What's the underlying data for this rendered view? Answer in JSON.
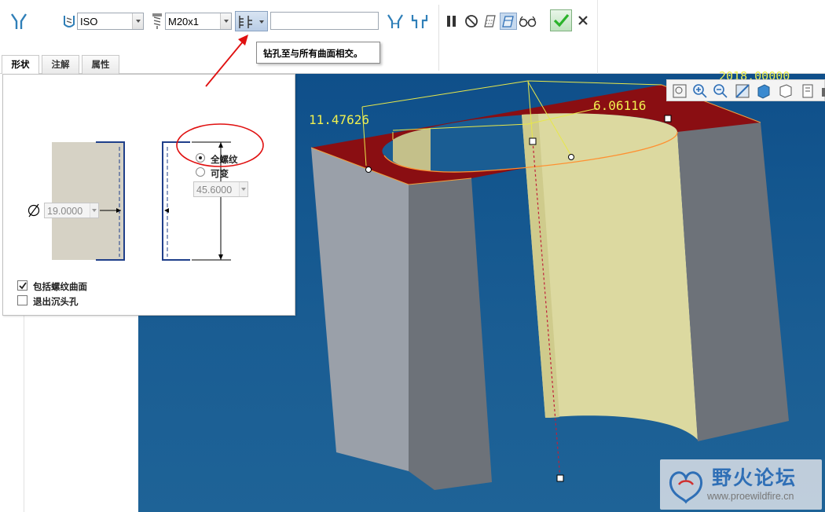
{
  "toolbar": {
    "standard_value": "ISO",
    "screw_size_value": "M20x1",
    "depth_value": "",
    "tooltip": "钻孔至与所有曲面相交。"
  },
  "tabs": [
    "形状",
    "注解",
    "属性"
  ],
  "shape_panel": {
    "diameter_value": "19.0000",
    "thread_options": [
      {
        "label": "全螺纹",
        "selected": true
      },
      {
        "label": "可变",
        "selected": false
      }
    ],
    "thread_depth_value": "45.6000",
    "checkboxes": [
      {
        "label": "包括螺纹曲面",
        "checked": true
      },
      {
        "label": "退出沉头孔",
        "checked": false
      }
    ]
  },
  "viewport": {
    "dimensions": [
      "11.47626",
      "6.06116",
      "2018.00000"
    ]
  },
  "watermark": {
    "title": "野火论坛",
    "url": "www.proewildfire.cn"
  },
  "colors": {
    "accept": "#2bb32b",
    "annotation_red": "#e01010",
    "viewport_blue": "#14578f",
    "body_red": "#8a0e12",
    "thread_surface": "#dcd9a0"
  }
}
